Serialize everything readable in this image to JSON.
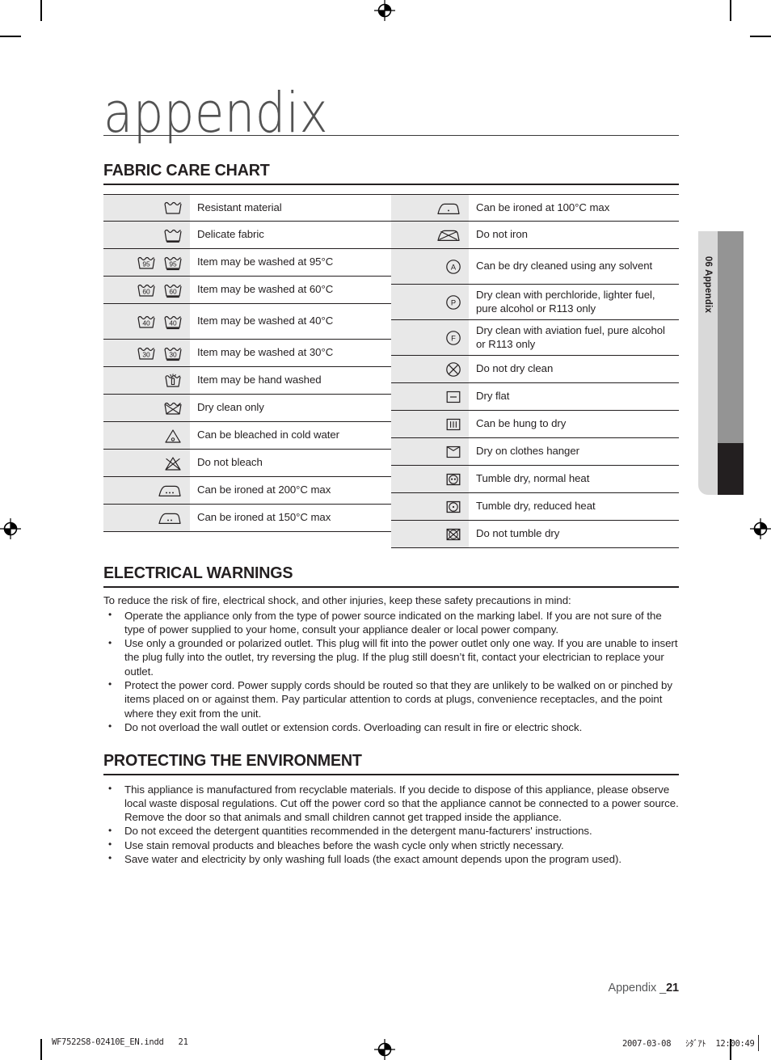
{
  "chapter": {
    "title": "appendix"
  },
  "sections": {
    "fabric_care": {
      "heading": "FABRIC CARE CHART"
    },
    "electrical": {
      "heading": "ELECTRICAL WARNINGS"
    },
    "environment": {
      "heading": "PROTECTING THE ENVIRONMENT"
    }
  },
  "care_chart": {
    "left_rows": [
      {
        "icons": [
          "washtub"
        ],
        "label": "Resistant material"
      },
      {
        "icons": [
          "washtub-delicate"
        ],
        "label": "Delicate fabric"
      },
      {
        "icons": [
          "washtub-95",
          "washtub-95-bar"
        ],
        "label": "Item may be washed at 95°C"
      },
      {
        "icons": [
          "washtub-60",
          "washtub-60-bar"
        ],
        "label": "Item may be washed at 60°C"
      },
      {
        "icons": [
          "washtub-40",
          "washtub-40-bar"
        ],
        "label": "Item may be washed at 40°C"
      },
      {
        "icons": [
          "washtub-30",
          "washtub-30-bar"
        ],
        "label": "Item may be washed at 30°C"
      },
      {
        "icons": [
          "hand-wash"
        ],
        "label": "Item may be hand washed"
      },
      {
        "icons": [
          "dry-clean-only"
        ],
        "label": "Dry clean only"
      },
      {
        "icons": [
          "bleach-cold"
        ],
        "label": "Can be bleached in cold water"
      },
      {
        "icons": [
          "do-not-bleach"
        ],
        "label": "Do not bleach"
      },
      {
        "icons": [
          "iron-3dot"
        ],
        "label": "Can be ironed at 200°C max"
      },
      {
        "icons": [
          "iron-2dot"
        ],
        "label": "Can be ironed at 150°C max"
      }
    ],
    "right_rows": [
      {
        "icons": [
          "iron-1dot"
        ],
        "label": "Can be ironed at 100°C max"
      },
      {
        "icons": [
          "do-not-iron"
        ],
        "label": "Do not iron"
      },
      {
        "icons": [
          "dryclean-a"
        ],
        "label": "Can be dry cleaned using any solvent"
      },
      {
        "icons": [
          "dryclean-p"
        ],
        "label": "Dry clean with perchloride, lighter fuel, pure alcohol or R113 only"
      },
      {
        "icons": [
          "dryclean-f"
        ],
        "label": "Dry clean with aviation fuel, pure alcohol or R113 only"
      },
      {
        "icons": [
          "do-not-dryclean"
        ],
        "label": "Do not dry clean"
      },
      {
        "icons": [
          "dry-flat"
        ],
        "label": "Dry flat"
      },
      {
        "icons": [
          "hang-to-dry"
        ],
        "label": "Can be hung to dry"
      },
      {
        "icons": [
          "drip-dry-hanger"
        ],
        "label": "Dry on clothes hanger"
      },
      {
        "icons": [
          "tumble-normal"
        ],
        "label": "Tumble dry, normal heat"
      },
      {
        "icons": [
          "tumble-reduced"
        ],
        "label": "Tumble dry, reduced heat"
      },
      {
        "icons": [
          "do-not-tumble"
        ],
        "label": "Do not tumble dry"
      }
    ],
    "icon_numbers": {
      "n95": "95",
      "n60": "60",
      "n40": "40",
      "n30": "30"
    },
    "dryclean_letters": {
      "a": "A",
      "p": "P",
      "f": "F"
    }
  },
  "electrical": {
    "lead": "To reduce the risk of fire, electrical shock, and other injuries, keep these safety precautions in mind:",
    "bullets": [
      "Operate the appliance only from the type of power source indicated on the marking label. If you are not sure of the type of power supplied to your home, consult your appliance dealer or local power company.",
      "Use only a grounded or polarized outlet. This plug will fit into the power outlet only one way. If you are unable to insert the plug fully into the outlet, try reversing the plug. If the plug still doesn’t fit, contact your electrician to replace your outlet.",
      "Protect the power cord. Power supply cords should be routed so that they are unlikely to be walked on or pinched by items placed on or against them. Pay particular attention to cords at plugs, convenience receptacles, and the point where they exit from the unit.",
      "Do not overload the wall outlet or extension cords. Overloading can result in fire or electric shock."
    ]
  },
  "environment": {
    "bullets": [
      "This appliance is manufactured from recyclable materials. If you decide to dispose of this appliance, please observe local waste disposal regulations. Cut off the power cord so that the appliance cannot be connected to a power source. Remove the door so that animals and small children cannot get trapped inside the appliance.",
      "Do not exceed the detergent quantities recommended in the detergent manu-facturers' instructions.",
      "Use stain removal products and bleaches before the wash cycle only when strictly necessary.",
      "Save water and electricity by only washing full loads (the exact amount depends upon the program used)."
    ]
  },
  "side_tab": {
    "label": "06 Appendix"
  },
  "footer": {
    "label": "Appendix _",
    "page_number": "21"
  },
  "print_slug": {
    "left": "WF7522S8-02410E_EN.indd   21",
    "right": "2007-03-08   ｼﾀﾞｱﾄ  12:00:49"
  }
}
